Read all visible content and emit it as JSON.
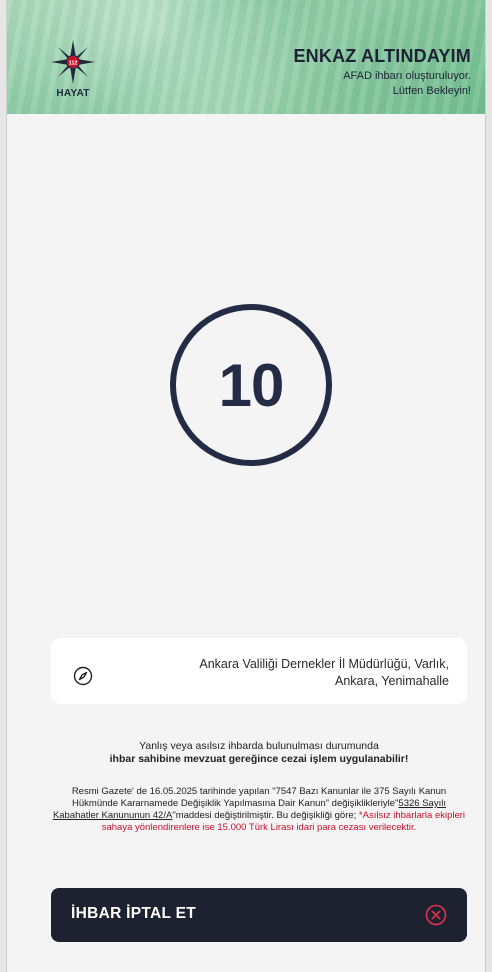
{
  "header": {
    "logo_text": "HAYAT",
    "logo_badge": "112",
    "title": "ENKAZ ALTINDAYIM",
    "subtitle_line1": "AFAD ihbarı oluşturuluyor.",
    "subtitle_line2": "Lütfen Bekleyin!"
  },
  "countdown": {
    "value": "10"
  },
  "location": {
    "icon": "compass-icon",
    "line1": "Ankara Valiliği Dernekler İl Müdürlüğü, Varlık,",
    "line2": "Ankara, Yenimahalle"
  },
  "warning": {
    "line1": "Yanlış veya asılsız ihbarda bulunulması durumunda",
    "line2": "ihbar sahibine mevzuat gereğince cezai işlem uygulanabilir!"
  },
  "legal": {
    "p1": "Resmi Gazete' de 16.05.2025 tarihinde yapılan \"7547 Bazı Kanunlar ile 375 Sayılı Kanun Hükmünde Kararnamede Değişiklik Yapılmasına Dair Kanun\" değişiklikleriyle\"",
    "link": "5326 Sayılı Kabahatler Kanununun 42/A",
    "p2": "\"maddesi değiştirilmiştir. Bu değişikliği göre; ",
    "red": "*Asılsız ihbarlarla ekipleri sahaya yönlendirenlere ise 15.000 Türk Lirası idari para cezası verilecektir."
  },
  "cancel": {
    "label": "İHBAR İPTAL ET",
    "icon": "close-circle-icon"
  },
  "colors": {
    "dark": "#1e2230",
    "ring": "#242c45",
    "red": "#c4122f",
    "header_green": "#7cc59a"
  }
}
